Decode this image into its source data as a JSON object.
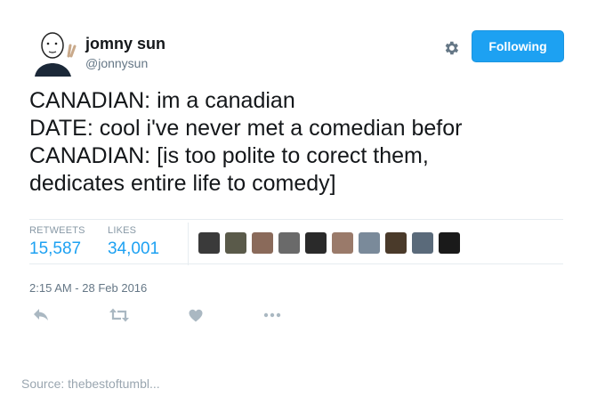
{
  "author": {
    "name": "jomny sun",
    "handle": "@jonnysun"
  },
  "follow_button": {
    "label": "Following"
  },
  "tweet_lines": [
    "CANADIAN: im a canadian",
    "DATE: cool i've never met a comedian befor",
    "CANADIAN: [is too polite to corect them,",
    "dedicates entire life to comedy]"
  ],
  "stats": {
    "retweets_label": "RETWEETS",
    "retweets_value": "15,587",
    "likes_label": "LIKES",
    "likes_value": "34,001"
  },
  "likers": [
    {
      "name": "liker-avatar-1",
      "color": "#3a3a3a"
    },
    {
      "name": "liker-avatar-2",
      "color": "#5a5a4a"
    },
    {
      "name": "liker-avatar-3",
      "color": "#8a6a5a"
    },
    {
      "name": "liker-avatar-4",
      "color": "#6a6a6a"
    },
    {
      "name": "liker-avatar-5",
      "color": "#2a2a2a"
    },
    {
      "name": "liker-avatar-6",
      "color": "#9a7a6a"
    },
    {
      "name": "liker-avatar-7",
      "color": "#7a8a9a"
    },
    {
      "name": "liker-avatar-8",
      "color": "#4a3a2a"
    },
    {
      "name": "liker-avatar-9",
      "color": "#5a6a7a"
    },
    {
      "name": "liker-avatar-10",
      "color": "#1a1a1a"
    }
  ],
  "timestamp": "2:15 AM - 28 Feb 2016",
  "actions": [
    "reply-icon",
    "retweet-icon",
    "like-icon",
    "more-icon"
  ],
  "colors": {
    "accent": "#1da1f2",
    "icon_gray": "#aab8c2",
    "muted_text": "#657786"
  },
  "source": "Source: thebestoftumbl..."
}
